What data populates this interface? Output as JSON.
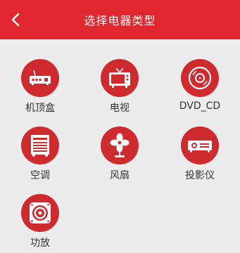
{
  "header": {
    "title": "选择电器类型",
    "back_icon": "chevron-left-icon"
  },
  "colors": {
    "header_bg": "#e0262f",
    "icon_bg": "#cf2a2e",
    "page_bg": "#ececec"
  },
  "devices": [
    {
      "label": "机顶盒",
      "icon": "set-top-box-icon"
    },
    {
      "label": "电视",
      "icon": "tv-icon"
    },
    {
      "label": "DVD_CD",
      "icon": "disc-icon"
    },
    {
      "label": "空调",
      "icon": "air-conditioner-icon"
    },
    {
      "label": "风扇",
      "icon": "fan-icon"
    },
    {
      "label": "投影仪",
      "icon": "projector-icon"
    },
    {
      "label": "功放",
      "icon": "speaker-icon"
    }
  ]
}
